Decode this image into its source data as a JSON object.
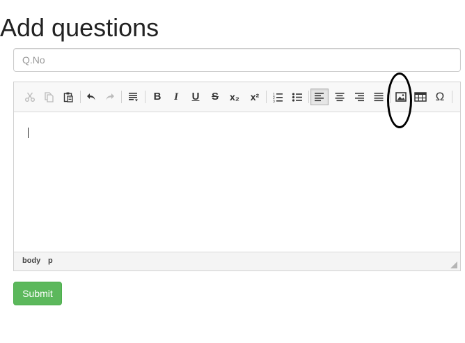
{
  "page": {
    "title": "Add questions"
  },
  "qno_field": {
    "placeholder": "Q.No",
    "value": ""
  },
  "editor": {
    "toolbar": [
      {
        "name": "cut-icon",
        "icon": "scissors",
        "state": "disabled"
      },
      {
        "name": "copy-icon",
        "icon": "copy",
        "state": "disabled"
      },
      {
        "name": "paste-icon",
        "icon": "clipboard",
        "state": "enabled"
      },
      {
        "name": "undo-icon",
        "icon": "undo-arrow",
        "state": "enabled"
      },
      {
        "name": "redo-icon",
        "icon": "redo-arrow",
        "state": "disabled"
      },
      {
        "name": "format-icon",
        "icon": "paragraph-format",
        "state": "enabled"
      },
      {
        "name": "bold-icon",
        "label": "B",
        "state": "enabled"
      },
      {
        "name": "italic-icon",
        "label": "I",
        "state": "enabled"
      },
      {
        "name": "underline-icon",
        "label": "U",
        "state": "enabled"
      },
      {
        "name": "strikethrough-icon",
        "label": "S",
        "state": "enabled"
      },
      {
        "name": "subscript-icon",
        "label": "x₂",
        "state": "enabled"
      },
      {
        "name": "superscript-icon",
        "label": "x²",
        "state": "enabled"
      },
      {
        "name": "numbered-list-icon",
        "icon": "ordered-list",
        "state": "enabled"
      },
      {
        "name": "bullet-list-icon",
        "icon": "unordered-list",
        "state": "enabled"
      },
      {
        "name": "align-left-icon",
        "icon": "align-left",
        "state": "active"
      },
      {
        "name": "align-center-icon",
        "icon": "align-center",
        "state": "enabled"
      },
      {
        "name": "align-right-icon",
        "icon": "align-right",
        "state": "enabled"
      },
      {
        "name": "align-justify-icon",
        "icon": "align-justify",
        "state": "enabled"
      },
      {
        "name": "insert-image-icon",
        "icon": "image",
        "state": "enabled",
        "annotated": true
      },
      {
        "name": "insert-table-icon",
        "icon": "table",
        "state": "enabled"
      },
      {
        "name": "special-character-icon",
        "label": "Ω",
        "state": "enabled"
      }
    ],
    "content": "",
    "status_path": [
      "body",
      "p"
    ]
  },
  "submit": {
    "label": "Submit"
  },
  "colors": {
    "submit_bg": "#5cb85c",
    "annotation": "#000000"
  }
}
